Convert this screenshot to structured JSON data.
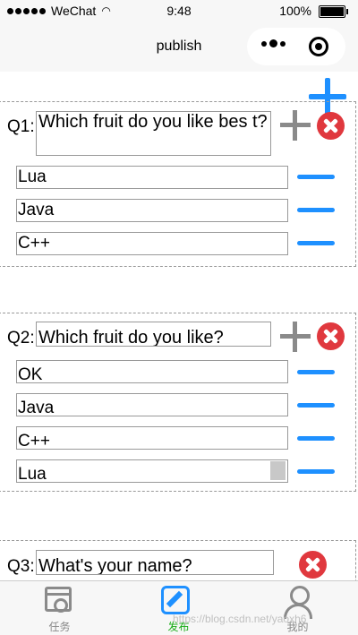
{
  "status_bar": {
    "carrier": "WeChat",
    "time": "9:48",
    "battery": "100%"
  },
  "nav": {
    "title": "publish"
  },
  "questions": [
    {
      "label": "Q1:",
      "value": "Which fruit do you like bes t?",
      "options": [
        "Lua",
        "Java",
        "C++"
      ]
    },
    {
      "label": "Q2:",
      "value": "Which fruit do you like?",
      "options": [
        "OK",
        "Java",
        "C++",
        "Lua"
      ]
    },
    {
      "label": "Q3:",
      "value": "What's your name?",
      "options": []
    }
  ],
  "tabbar": {
    "items": [
      {
        "label": "任务",
        "icon": "calendar-settings-icon"
      },
      {
        "label": "发布",
        "icon": "edit-icon",
        "active": true
      },
      {
        "label": "我的",
        "icon": "user-icon"
      }
    ]
  },
  "watermark": "https://blog.csdn.net/yaoxh6",
  "colors": {
    "accent": "#1e90ff",
    "delete": "#e0383e",
    "active_tab": "#1aad19",
    "add_gray": "#8a8a8a"
  }
}
